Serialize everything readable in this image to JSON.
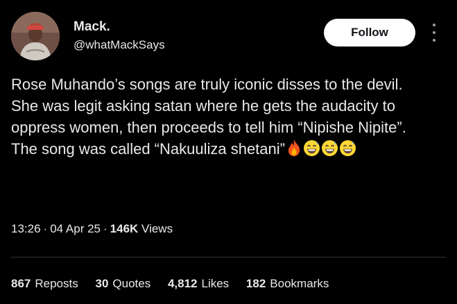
{
  "author": {
    "name": "Mack.",
    "handle": "@whatMackSays",
    "avatar": "avatar-photo"
  },
  "follow_label": "Follow",
  "more_icon": "more-vertical-icon",
  "tweet": {
    "lines": [
      "Rose Muhando’s songs are truly iconic disses to the devil.",
      "She was legit asking satan where he gets the audacity to oppress women, then proceeds to tell him “Nipishe Nipite”.",
      "The song was called “Nakuuliza shetani”"
    ],
    "emojis": [
      "fire-emoji",
      "grinning-sweat-emoji",
      "grinning-sweat-emoji",
      "grinning-sweat-emoji"
    ]
  },
  "meta": {
    "time": "13:26",
    "separator": "·",
    "date": "04 Apr 25",
    "views_count": "146K",
    "views_label": "Views"
  },
  "stats": [
    {
      "count": "867",
      "label": "Reposts"
    },
    {
      "count": "30",
      "label": "Quotes"
    },
    {
      "count": "4,812",
      "label": "Likes"
    },
    {
      "count": "182",
      "label": "Bookmarks"
    }
  ],
  "colors": {
    "background": "#000000",
    "text": "#e7e9ea",
    "button_bg": "#ffffff",
    "button_text": "#0f1419",
    "divider": "#2f3336"
  }
}
